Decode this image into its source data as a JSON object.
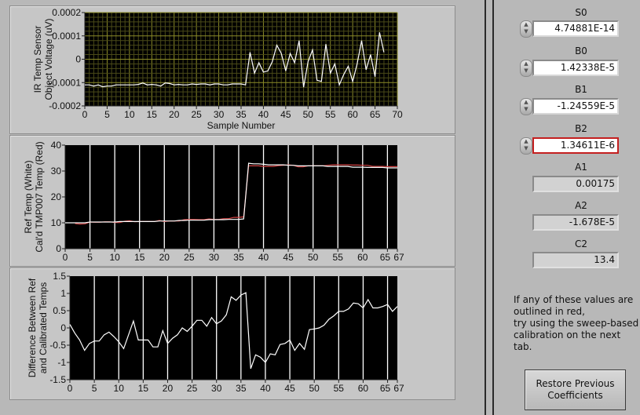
{
  "chart_data": [
    {
      "type": "line",
      "title": "",
      "ylabel": [
        "IR Temp Sensor",
        "Object Voltage (uV)"
      ],
      "xlabel": "Sample Number",
      "xlim": [
        0,
        70
      ],
      "ylim": [
        -0.0002,
        0.0002
      ],
      "xticks": [
        0,
        5,
        10,
        15,
        20,
        25,
        30,
        35,
        40,
        45,
        50,
        55,
        60,
        65,
        70
      ],
      "yticks": [
        -0.0002,
        -0.0001,
        0,
        0.0001,
        0.0002
      ],
      "ytick_labels": [
        "-0.0002",
        "-0.0001",
        "0",
        "0.0001",
        "0.0002"
      ],
      "grid": "on",
      "colors": {
        "plot_bg": "#000000",
        "grid": "#8c8c28",
        "grid_minor": "#4a4a18"
      },
      "series": [
        {
          "name": "Object Voltage",
          "color": "#ffffff",
          "values": [
            -0.00011,
            -0.00011,
            -0.000115,
            -0.00011,
            -0.000118,
            -0.000115,
            -0.000115,
            -0.00011,
            -0.00011,
            -0.00011,
            -0.00011,
            -0.00011,
            -0.000108,
            -0.000102,
            -0.00011,
            -0.000108,
            -0.00011,
            -0.000115,
            -0.000102,
            -0.000104,
            -0.00011,
            -0.000108,
            -0.00011,
            -0.00011,
            -0.000106,
            -0.000108,
            -0.000106,
            -0.000106,
            -0.00011,
            -0.000106,
            -0.000106,
            -0.00011,
            -0.00011,
            -0.000106,
            -0.000106,
            -0.000106,
            -0.00011,
            3e-05,
            -6e-05,
            -1.5e-05,
            -5.5e-05,
            -5e-05,
            -1e-05,
            6e-05,
            2.5e-05,
            -5e-05,
            2.5e-05,
            -1.5e-05,
            8e-05,
            -0.00012,
            -1e-05,
            4e-05,
            -9e-05,
            -9.5e-05,
            6.5e-05,
            -6e-05,
            -2e-05,
            -0.00011,
            -6.5e-05,
            -3e-05,
            -9.5e-05,
            -2e-05,
            8e-05,
            -4.5e-05,
            2e-05,
            -7.5e-05,
            0.000115,
            3e-05
          ]
        }
      ]
    },
    {
      "type": "line",
      "title": "",
      "ylabel": [
        "Ref Temp (White)",
        "Cal'd TMP007 Temp (Red)"
      ],
      "xlabel": "",
      "xlim": [
        0,
        67
      ],
      "ylim": [
        0,
        40
      ],
      "xticks": [
        0,
        5,
        10,
        15,
        20,
        25,
        30,
        35,
        40,
        45,
        50,
        55,
        60,
        65,
        67
      ],
      "yticks": [
        0,
        10,
        20,
        30,
        40
      ],
      "ytick_labels": [
        "0",
        "10",
        "20",
        "30",
        "40"
      ],
      "grid": "vertical",
      "colors": {
        "plot_bg": "#000000",
        "grid": "#ffffff"
      },
      "series": [
        {
          "name": "Ref Temp",
          "color": "#ffffff",
          "values": [
            10.0,
            10.0,
            10.0,
            10.0,
            10.0,
            10.3,
            10.3,
            10.3,
            10.3,
            10.3,
            10.3,
            10.5,
            10.5,
            10.5,
            10.5,
            10.5,
            10.5,
            10.5,
            10.5,
            10.7,
            10.7,
            10.7,
            10.7,
            10.9,
            10.9,
            11.0,
            11.0,
            11.0,
            11.0,
            11.2,
            11.2,
            11.2,
            11.2,
            11.3,
            11.3,
            11.3,
            11.5,
            33.0,
            32.8,
            32.8,
            32.6,
            32.4,
            32.4,
            32.4,
            32.4,
            32.2,
            32.2,
            32.0,
            32.0,
            32.0,
            32.0,
            32.0,
            32.0,
            31.8,
            31.8,
            31.8,
            31.8,
            31.8,
            31.5,
            31.5,
            31.5,
            31.4,
            31.4,
            31.4,
            31.4,
            31.2,
            31.2,
            31.2
          ]
        },
        {
          "name": "Cal'd TMP007 Temp",
          "color": "#d04040",
          "values": [
            null,
            null,
            9.7,
            9.5,
            9.6,
            10.3,
            10.2,
            10.2,
            10.4,
            10.4,
            10.1,
            10.1,
            10.6,
            10.8,
            10.4,
            10.5,
            10.5,
            10.5,
            10.5,
            10.9,
            10.5,
            10.7,
            10.7,
            10.7,
            11.2,
            11.3,
            11.3,
            11.2,
            11.2,
            11.5,
            11.3,
            11.3,
            11.6,
            11.6,
            12.1,
            12.1,
            12.3,
            32.0,
            32.0,
            32.0,
            31.8,
            31.8,
            31.8,
            32.1,
            32.2,
            32.4,
            32.2,
            31.6,
            31.6,
            32.0,
            32.0,
            32.0,
            32.0,
            32.2,
            32.4,
            32.4,
            32.4,
            32.4,
            32.3,
            32.3,
            32.2,
            32.2,
            31.8,
            31.8,
            31.8,
            31.7,
            31.7,
            31.7
          ]
        }
      ]
    },
    {
      "type": "line",
      "title": "",
      "ylabel": [
        "Difference Between Ref",
        "and Calibrated Temps"
      ],
      "xlabel": "",
      "xlim": [
        0,
        67
      ],
      "ylim": [
        -1.5,
        1.5
      ],
      "xticks": [
        0,
        5,
        10,
        15,
        20,
        25,
        30,
        35,
        40,
        45,
        50,
        55,
        60,
        65,
        67
      ],
      "yticks": [
        -1.5,
        -1,
        -0.5,
        0,
        0.5,
        1,
        1.5
      ],
      "ytick_labels": [
        "-1.5",
        "-1",
        "-0.5",
        "0",
        "0.5",
        "1",
        "1.5"
      ],
      "grid": "vertical",
      "colors": {
        "plot_bg": "#000000",
        "grid": "#ffffff"
      },
      "series": [
        {
          "name": "Difference",
          "color": "#ffffff",
          "values": [
            0.1,
            -0.15,
            -0.35,
            -0.65,
            -0.45,
            -0.38,
            -0.38,
            -0.2,
            -0.12,
            -0.25,
            -0.4,
            -0.6,
            -0.2,
            0.2,
            -0.35,
            -0.35,
            -0.35,
            -0.55,
            -0.55,
            -0.08,
            -0.45,
            -0.3,
            -0.2,
            0,
            -0.1,
            0.05,
            0.22,
            0.22,
            0.05,
            0.3,
            0.12,
            0.2,
            0.38,
            0.9,
            0.8,
            0.95,
            1.02,
            -1.18,
            -0.78,
            -0.85,
            -1.0,
            -0.75,
            -0.78,
            -0.48,
            -0.45,
            -0.35,
            -0.65,
            -0.45,
            -0.62,
            -0.05,
            -0.03,
            0,
            0.08,
            0.25,
            0.35,
            0.48,
            0.48,
            0.55,
            0.72,
            0.7,
            0.58,
            0.82,
            0.58,
            0.58,
            0.62,
            0.68,
            0.48,
            0.62
          ]
        }
      ]
    }
  ],
  "controls": [
    {
      "label": "S0",
      "value": "4.74881E-14"
    },
    {
      "label": "B0",
      "value": "1.42338E-5"
    },
    {
      "label": "B1",
      "value": "-1.24559E-5"
    },
    {
      "label": "B2",
      "value": "1.34611E-6"
    }
  ],
  "indicators": [
    {
      "label": "A1",
      "value": "0.00175"
    },
    {
      "label": "A2",
      "value": "-1.678E-5"
    },
    {
      "label": "C2",
      "value": "13.4"
    }
  ],
  "note": [
    "If any of these values are",
    "outlined in red,",
    "try using the sweep-based",
    "calibration on the next",
    "tab."
  ],
  "restore_button": [
    "Restore Previous",
    "Coefficients"
  ],
  "colors": {
    "invalid_outline": "#c42020",
    "background": "#b8b8b8"
  }
}
